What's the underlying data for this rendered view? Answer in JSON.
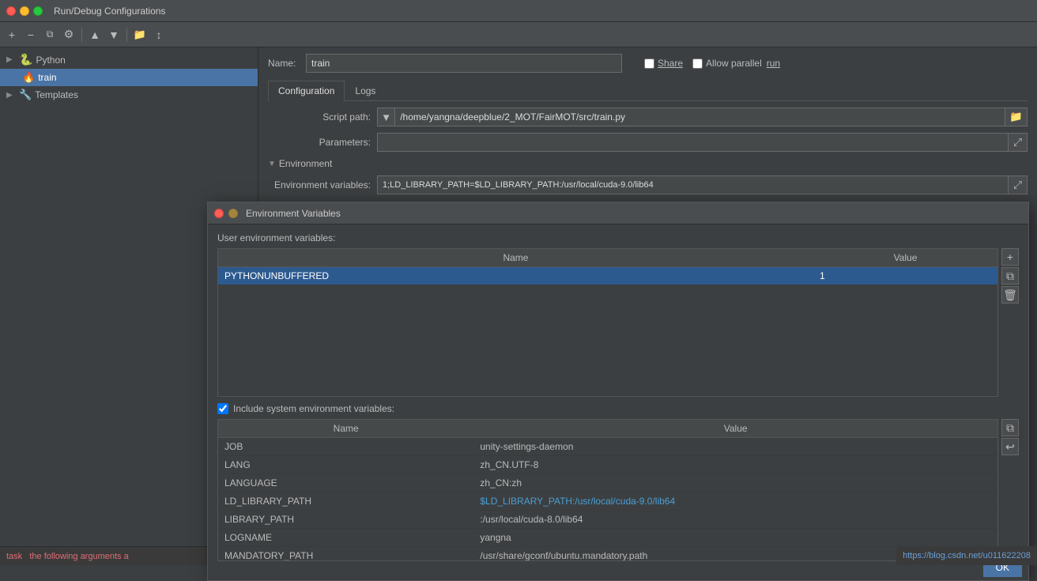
{
  "window": {
    "title": "Run/Debug Configurations",
    "dots": [
      "close",
      "minimize",
      "maximize"
    ]
  },
  "toolbar": {
    "buttons": [
      "+",
      "−",
      "⧉",
      "⚙",
      "▲",
      "▼",
      "📁",
      "↕"
    ]
  },
  "sidebar": {
    "python_label": "Python",
    "train_label": "train",
    "templates_label": "Templates"
  },
  "config_panel": {
    "name_label": "Name:",
    "name_value": "train",
    "share_label": "Share",
    "allow_parallel_label": "Allow parallel",
    "run_label": "run",
    "tabs": [
      "Configuration",
      "Logs"
    ],
    "active_tab": "Configuration",
    "script_path_label": "Script path:",
    "script_path_value": "/home/yangna/deepblue/2_MOT/FairMOT/src/train.py",
    "parameters_label": "Parameters:",
    "parameters_value": "",
    "environment_section": "Environment",
    "env_variables_label": "Environment variables:",
    "env_variables_value": "1;LD_LIBRARY_PATH=$LD_LIBRARY_PATH:/usr/local/cuda-9.0/lib64"
  },
  "dialog": {
    "title": "Environment Variables",
    "user_env_label": "User environment variables:",
    "user_table": {
      "headers": [
        "Name",
        "Value"
      ],
      "rows": [
        {
          "name": "PYTHONUNBUFFERED",
          "value": "1",
          "selected": true
        }
      ]
    },
    "include_system_label": "Include system environment variables:",
    "system_table": {
      "headers": [
        "Name",
        "Value"
      ],
      "rows": [
        {
          "name": "JOB",
          "value": "unity-settings-daemon",
          "link": false
        },
        {
          "name": "LANG",
          "value": "zh_CN.UTF-8",
          "link": false
        },
        {
          "name": "LANGUAGE",
          "value": "zh_CN:zh",
          "link": false
        },
        {
          "name": "LD_LIBRARY_PATH",
          "value": "$LD_LIBRARY_PATH:/usr/local/cuda-9.0/lib64",
          "link": true
        },
        {
          "name": "LIBRARY_PATH",
          "value": ":/usr/local/cuda-8.0/lib64",
          "link": false
        },
        {
          "name": "LOGNAME",
          "value": "yangna",
          "link": false
        },
        {
          "name": "MANDATORY_PATH",
          "value": "/usr/share/gconf/ubuntu.mandatory.path",
          "link": false
        }
      ]
    },
    "ok_button": "OK"
  },
  "status_bar": {
    "line1": "task",
    "line2": "the following arguments a"
  },
  "url_bar": {
    "text": "https://blog.csdn.net/u011622208"
  }
}
